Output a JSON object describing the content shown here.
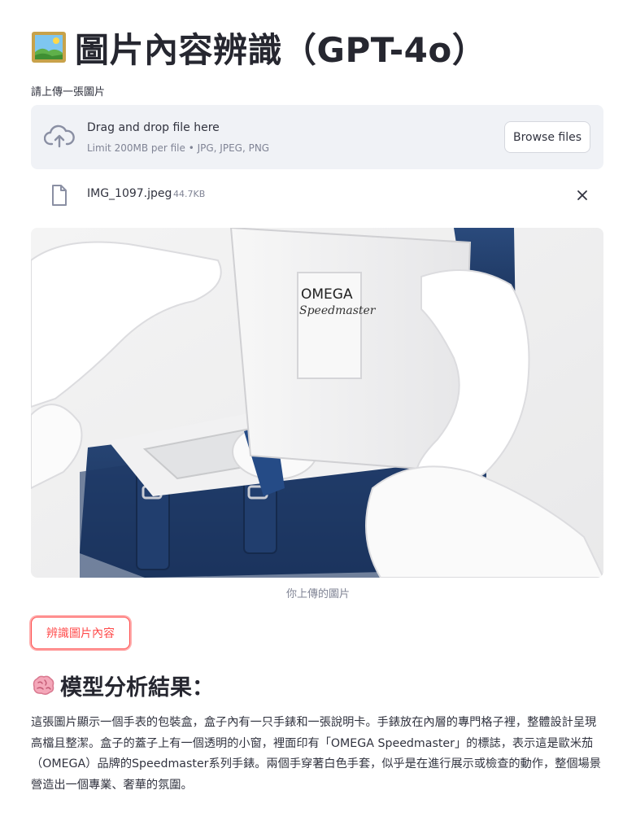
{
  "page": {
    "title": "圖片內容辨識（GPT-4o）",
    "title_icon": "framed-picture-emoji"
  },
  "uploader": {
    "label": "請上傳一張圖片",
    "drop_title": "Drag and drop file here",
    "drop_subtitle": "Limit 200MB per file • JPG, JPEG, PNG",
    "browse_label": "Browse files",
    "icon": "cloud-upload-icon"
  },
  "file": {
    "name": "IMG_1097.jpeg",
    "size": "44.7KB",
    "icon": "file-icon",
    "remove_icon": "close-icon"
  },
  "image": {
    "caption": "你上傳的圖片",
    "brand_text": "OMEGA",
    "model_text": "Speedmaster"
  },
  "actions": {
    "analyze_label": "辨識圖片內容"
  },
  "result": {
    "icon": "brain-emoji",
    "heading": "模型分析結果：",
    "text": "這張圖片顯示一個手表的包裝盒，盒子內有一只手錶和一張說明卡。手錶放在內層的專門格子裡，整體設計呈現高檔且整潔。盒子的蓋子上有一個透明的小窗，裡面印有「OMEGA Speedmaster」的標誌，表示這是歐米茄（OMEGA）品牌的Speedmaster系列手錶。兩個手穿著白色手套，似乎是在進行展示或檢查的動作，整個場景營造出一個專業、奢華的氛圍。"
  },
  "colors": {
    "accent": "#ff4b4b",
    "text": "#31333f",
    "muted": "#808495",
    "dropzone_bg": "#f0f2f6",
    "box_navy": "#1f3a66"
  }
}
